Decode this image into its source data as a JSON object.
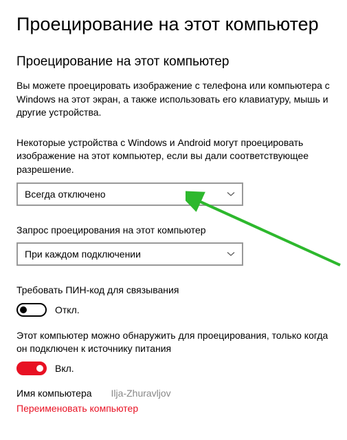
{
  "page_title": "Проецирование на этот компьютер",
  "section_title": "Проецирование на этот компьютер",
  "description": "Вы можете проецировать изображение с телефона или компьютера с Windows на этот экран, а также использовать его клавиатуру, мышь и другие устройства.",
  "setting1": {
    "label": "Некоторые устройства с Windows и Android могут проецировать изображение на этот компьютер, если вы дали соответствующее разрешение.",
    "value": "Всегда отключено"
  },
  "setting2": {
    "label": "Запрос проецирования на этот компьютер",
    "value": "При каждом подключении"
  },
  "setting3": {
    "label": "Требовать ПИН-код для связывания",
    "toggle_state": "off",
    "toggle_label": "Откл."
  },
  "setting4": {
    "label": "Этот компьютер можно обнаружить для проецирования, только когда он подключен к источнику питания",
    "toggle_state": "on",
    "toggle_label": "Вкл."
  },
  "computer_name": {
    "label": "Имя компьютера",
    "value": "Ilja-Zhuravljov"
  },
  "rename_link": "Переименовать компьютер"
}
